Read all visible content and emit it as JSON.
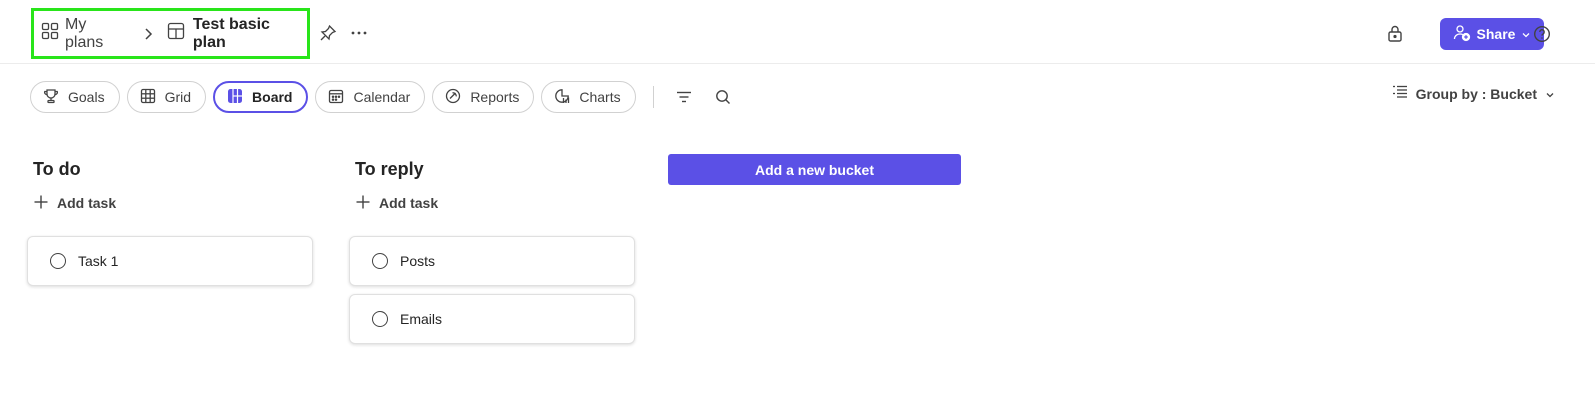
{
  "breadcrumb": {
    "root_label": "My plans",
    "current_label": "Test basic plan",
    "root_icon": "grid-apps-icon",
    "current_icon": "board-layout-icon",
    "highlight_color": "#29e51a"
  },
  "header": {
    "share_label": "Share",
    "accent_color": "#5b50e6"
  },
  "tabs": [
    {
      "label": "Goals",
      "icon": "trophy-icon"
    },
    {
      "label": "Grid",
      "icon": "table-icon"
    },
    {
      "label": "Board",
      "icon": "board-icon",
      "active": true
    },
    {
      "label": "Calendar",
      "icon": "calendar-icon"
    },
    {
      "label": "Reports",
      "icon": "reports-icon"
    },
    {
      "label": "Charts",
      "icon": "charts-icon"
    }
  ],
  "toolbar": {
    "group_by_label": "Group by : Bucket"
  },
  "buckets": [
    {
      "title": "To do",
      "add_task_label": "Add task",
      "tasks": [
        "Task 1"
      ]
    },
    {
      "title": "To reply",
      "add_task_label": "Add task",
      "tasks": [
        "Posts",
        "Emails"
      ]
    }
  ],
  "add_bucket_label": "Add a new bucket"
}
